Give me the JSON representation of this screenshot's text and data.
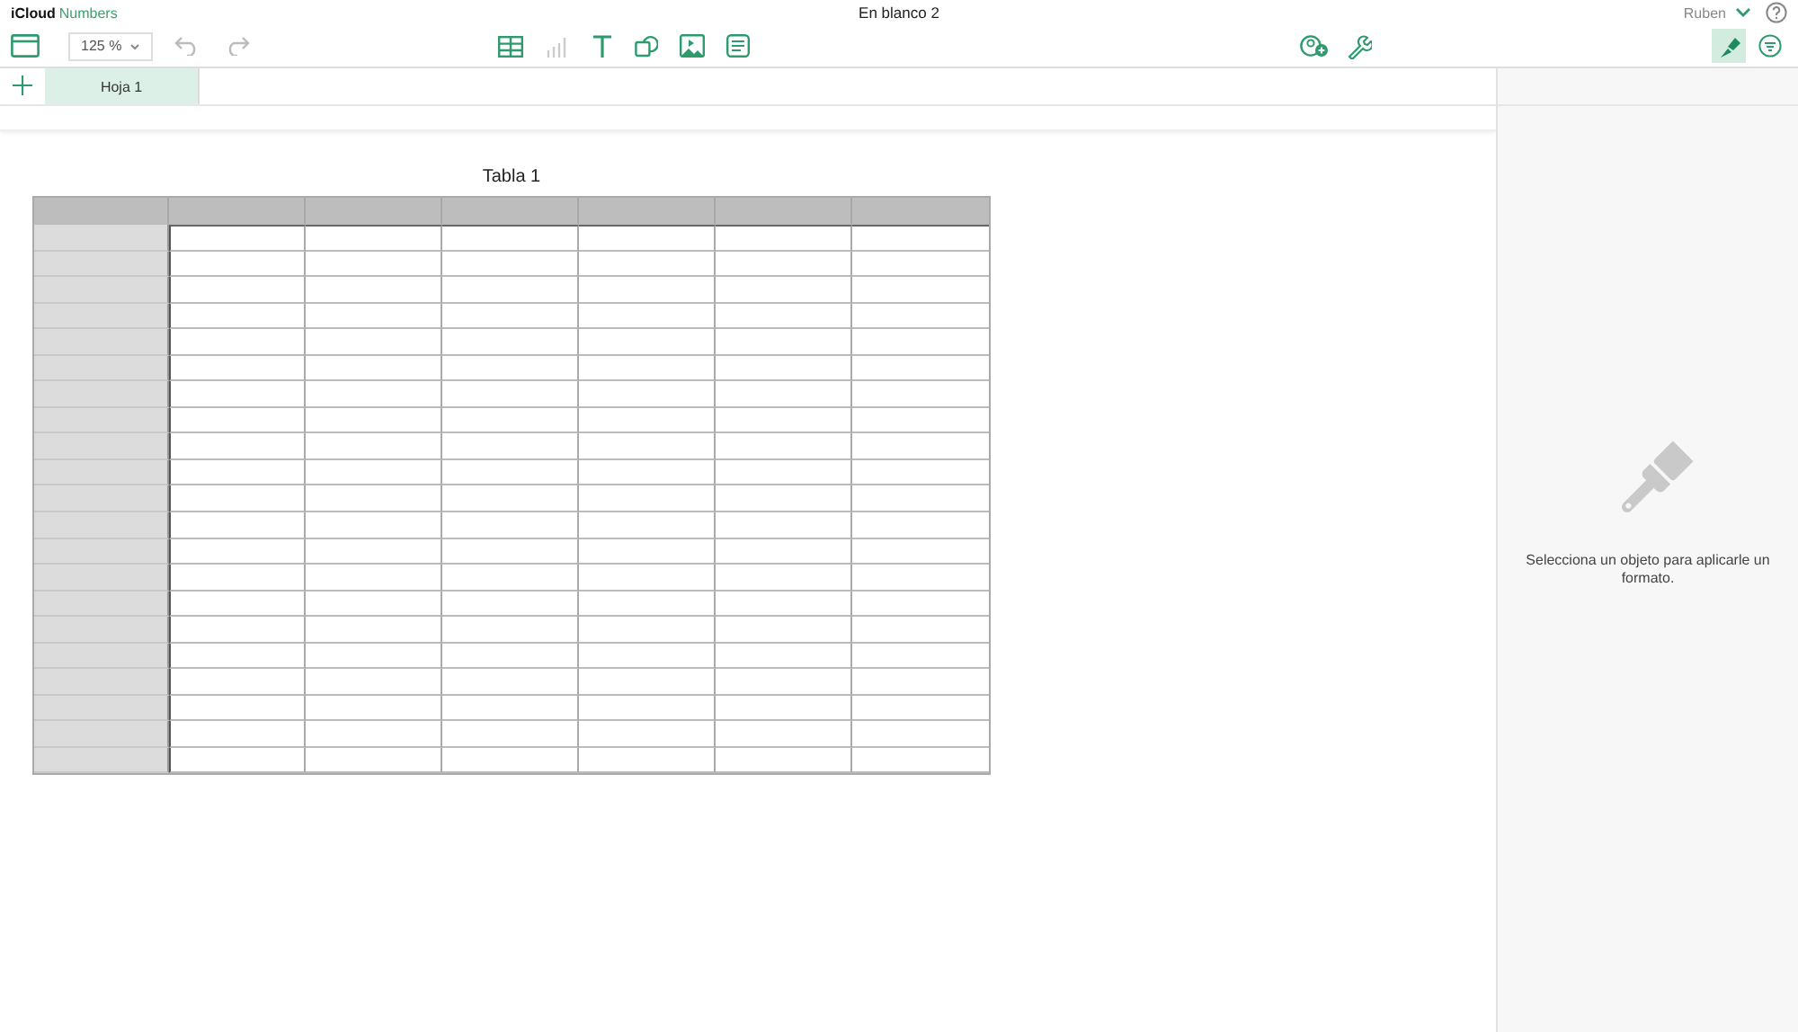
{
  "app": {
    "brand": "iCloud",
    "product": "Numbers"
  },
  "document": {
    "title": "En blanco 2"
  },
  "user": {
    "name": "Ruben"
  },
  "toolbar": {
    "zoom": "125 %"
  },
  "inspector_buttons": [
    {
      "kind": "format",
      "selected": true
    },
    {
      "kind": "sort",
      "selected": false
    }
  ],
  "sheet_tabs": [
    {
      "label": "Hoja 1",
      "selected": true
    }
  ],
  "table": {
    "title": "Tabla 1"
  },
  "inspector": {
    "message": "Selecciona un objeto para aplicarle un formato."
  }
}
